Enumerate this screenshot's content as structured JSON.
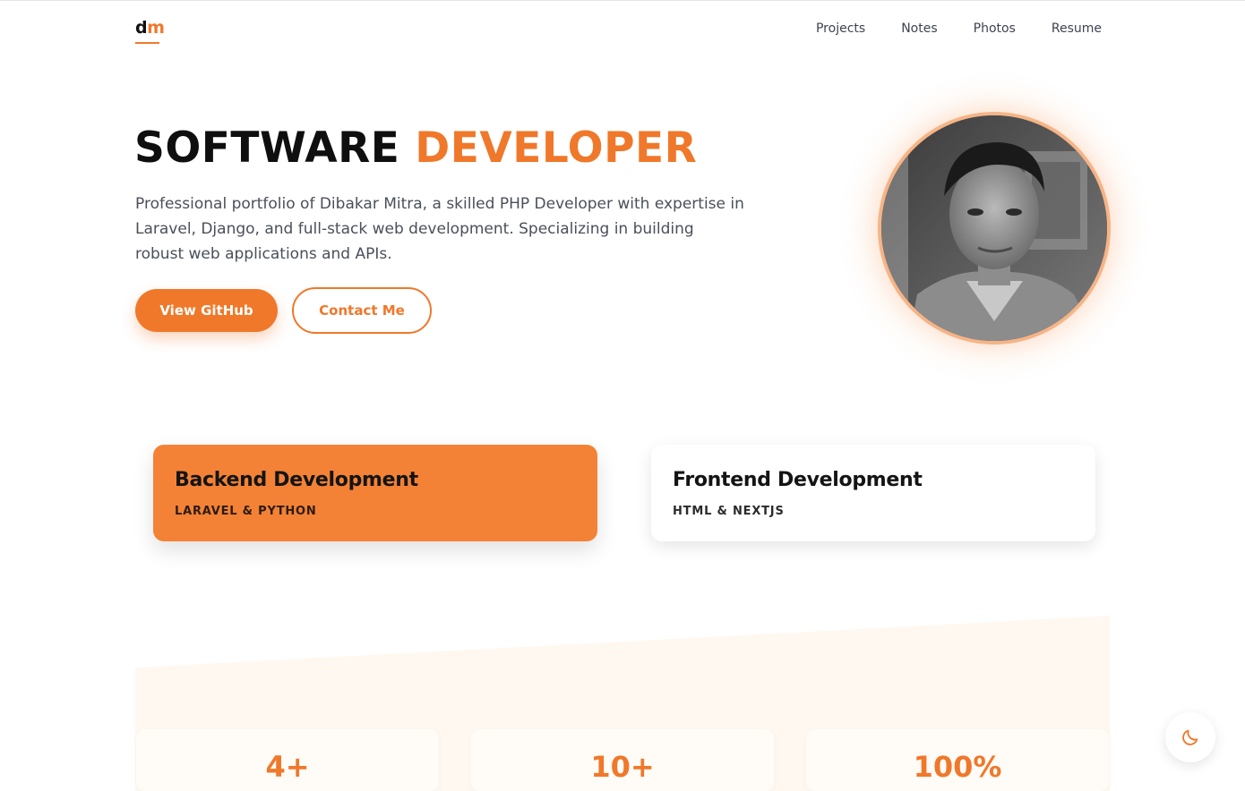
{
  "header": {
    "logo_d": "d",
    "logo_m": "m",
    "nav": [
      {
        "label": "Projects"
      },
      {
        "label": "Notes"
      },
      {
        "label": "Photos"
      },
      {
        "label": "Resume"
      }
    ]
  },
  "hero": {
    "title_part1": "SOFTWARE",
    "title_part2": "DEVELOPER",
    "description": "Professional portfolio of Dibakar Mitra, a skilled PHP Developer with expertise in Laravel, Django, and full-stack web development. Specializing in building robust web applications and APIs.",
    "primary_button": "View GitHub",
    "secondary_button": "Contact Me"
  },
  "cards": [
    {
      "title": "Backend Development",
      "subtitle": "LARAVEL & PYTHON"
    },
    {
      "title": "Frontend Development",
      "subtitle": "HTML & NEXTJS"
    }
  ],
  "stats": [
    {
      "value": "4+"
    },
    {
      "value": "10+"
    },
    {
      "value": "100%"
    }
  ],
  "icons": {
    "theme_toggle": "moon-icon"
  },
  "colors": {
    "accent": "#f0782a",
    "backend_card": "#f38236",
    "stats_band": "#fff8f1"
  }
}
